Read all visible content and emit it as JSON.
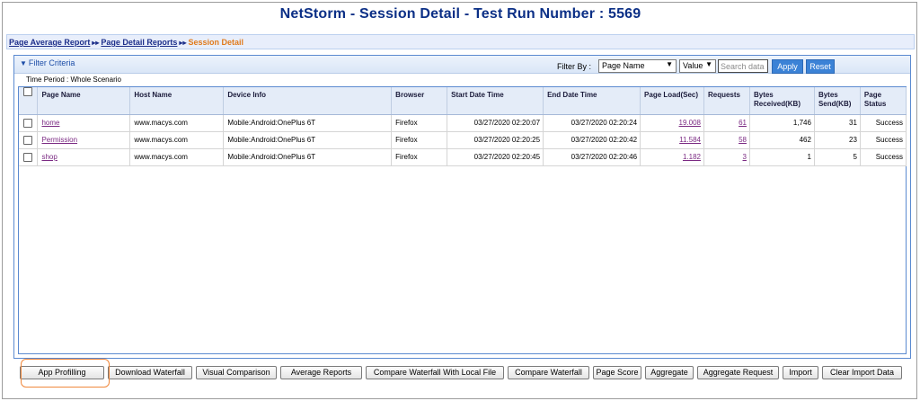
{
  "header": {
    "title": "NetStorm - Session Detail - Test Run Number : 5569"
  },
  "breadcrumb": {
    "items": [
      {
        "label": "Page Average Report"
      },
      {
        "label": "Page Detail Reports"
      }
    ],
    "separator": "▸▸",
    "current": "Session Detail"
  },
  "filter": {
    "title": "Filter Criteria",
    "filter_by_label": "Filter By :",
    "field_select": "Page Name",
    "value_select": "Value",
    "search_placeholder": "Search data",
    "apply_label": "Apply",
    "reset_label": "Reset",
    "time_period": "Time Period : Whole Scenario"
  },
  "table": {
    "columns": [
      "Page Name",
      "Host Name",
      "Device Info",
      "Browser",
      "Start Date Time",
      "End Date Time",
      "Page Load(Sec)",
      "Requests",
      "Bytes Received(KB)",
      "Bytes Send(KB)",
      "Page Status"
    ],
    "rows": [
      {
        "page_name": "home",
        "host": "www.macys.com",
        "device": "Mobile:Android:OnePlus 6T",
        "browser": "Firefox",
        "start": "03/27/2020 02:20:07",
        "end": "03/27/2020 02:20:24",
        "load": "19.008",
        "requests": "61",
        "recv": "1,746",
        "send": "31",
        "status": "Success"
      },
      {
        "page_name": "Permission",
        "host": "www.macys.com",
        "device": "Mobile:Android:OnePlus 6T",
        "browser": "Firefox",
        "start": "03/27/2020 02:20:25",
        "end": "03/27/2020 02:20:42",
        "load": "11.584",
        "requests": "58",
        "recv": "462",
        "send": "23",
        "status": "Success"
      },
      {
        "page_name": "shop",
        "host": "www.macys.com",
        "device": "Mobile:Android:OnePlus 6T",
        "browser": "Firefox",
        "start": "03/27/2020 02:20:45",
        "end": "03/27/2020 02:20:46",
        "load": "1.182",
        "requests": "3",
        "recv": "1",
        "send": "5",
        "status": "Success"
      }
    ]
  },
  "buttons": [
    "App Profilling",
    "Download Waterfall",
    "Visual Comparison",
    "Average Reports",
    "Compare Waterfall With Local File",
    "Compare Waterfall",
    "Page Score",
    "Aggregate",
    "Aggregate Request",
    "Import",
    "Clear Import Data"
  ],
  "colors": {
    "title": "#0b2f86",
    "accent": "#3b82d6",
    "highlight": "#f0883c",
    "breadcrumb_current": "#e07a1c",
    "link": "#7b2a83"
  }
}
